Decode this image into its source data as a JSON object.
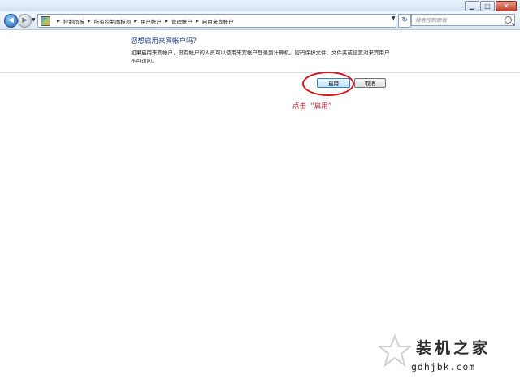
{
  "window": {
    "controls": {
      "minimize": "▁",
      "maximize": "□",
      "close": "✕"
    }
  },
  "addressbar": {
    "breadcrumbs": [
      "控制面板",
      "所有控制面板项",
      "用户帐户",
      "管理帐户",
      "启用来宾帐户"
    ],
    "search_placeholder": "搜索控制面板"
  },
  "content": {
    "heading": "您想启用来宾帐户吗?",
    "description": "如果启用来宾帐户，没有帐户的人员可以使用来宾帐户登录到计算机。密码保护文件、文件夹或设置对来宾用户不可访问。",
    "enable_label": "启用",
    "cancel_label": "取消"
  },
  "annotation": {
    "text": "点击  “启用”",
    "color": "#c8202a"
  },
  "watermark": {
    "title": "装机之家",
    "url": "gdhjbk.com"
  }
}
